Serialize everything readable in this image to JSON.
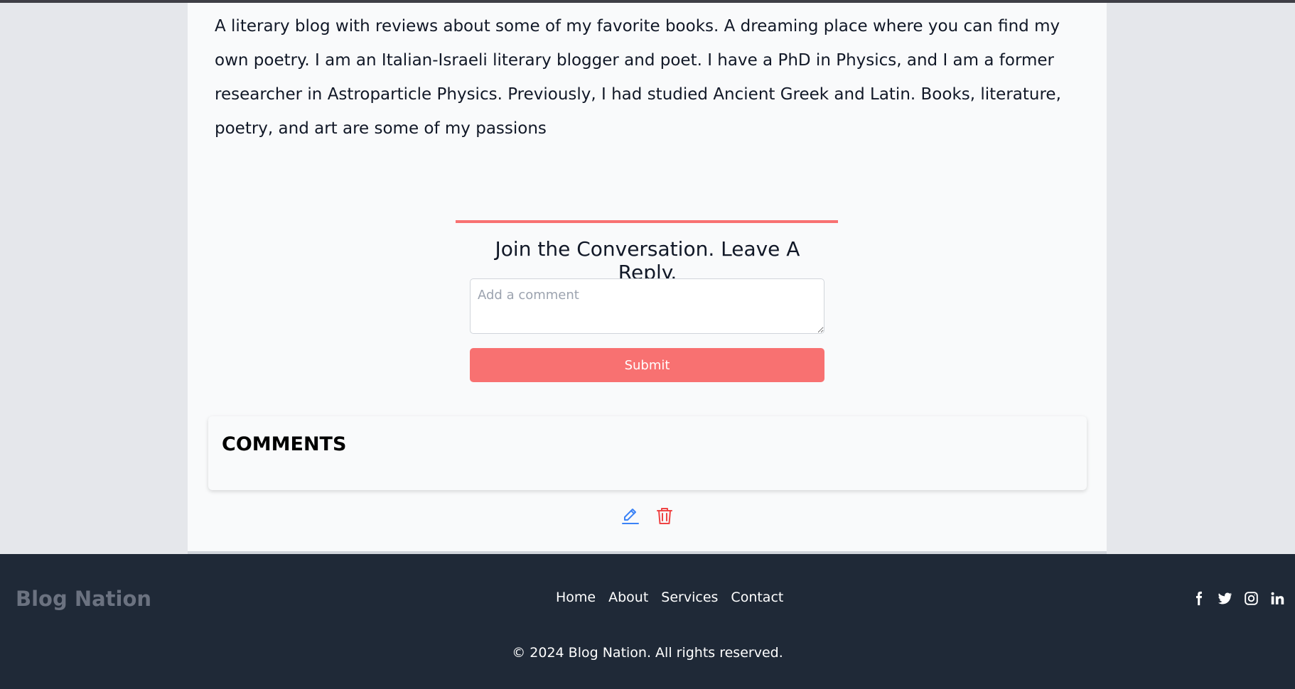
{
  "post": {
    "author_bio": "A literary blog with reviews about some of my favorite books. A dreaming place where you can find my own poetry. I am an Italian-Israeli literary blogger and poet. I have a PhD in Physics, and I am a former researcher in Astroparticle Physics. Previously, I had studied Ancient Greek and Latin. Books, literature, poetry, and art are some of my passions"
  },
  "reply": {
    "title": "Join the Conversation. Leave A Reply.",
    "comment_placeholder": "Add a comment",
    "submit_label": "Submit"
  },
  "comments": {
    "heading": "COMMENTS",
    "actions": [
      {
        "icon": "pencil-icon",
        "color": "#3b82f6"
      },
      {
        "icon": "trash-icon",
        "color": "#ef4444"
      }
    ]
  },
  "footer": {
    "brand": "Blog Nation",
    "nav": [
      "Home",
      "About",
      "Services",
      "Contact"
    ],
    "social_icons": [
      "facebook-icon",
      "twitter-icon",
      "instagram-icon",
      "linkedin-icon"
    ],
    "copyright": "© 2024 Blog Nation. All rights reserved."
  },
  "colors": {
    "accent": "#f87171",
    "footer_bg": "#1f2937",
    "page_bg": "#e5e7eb"
  }
}
